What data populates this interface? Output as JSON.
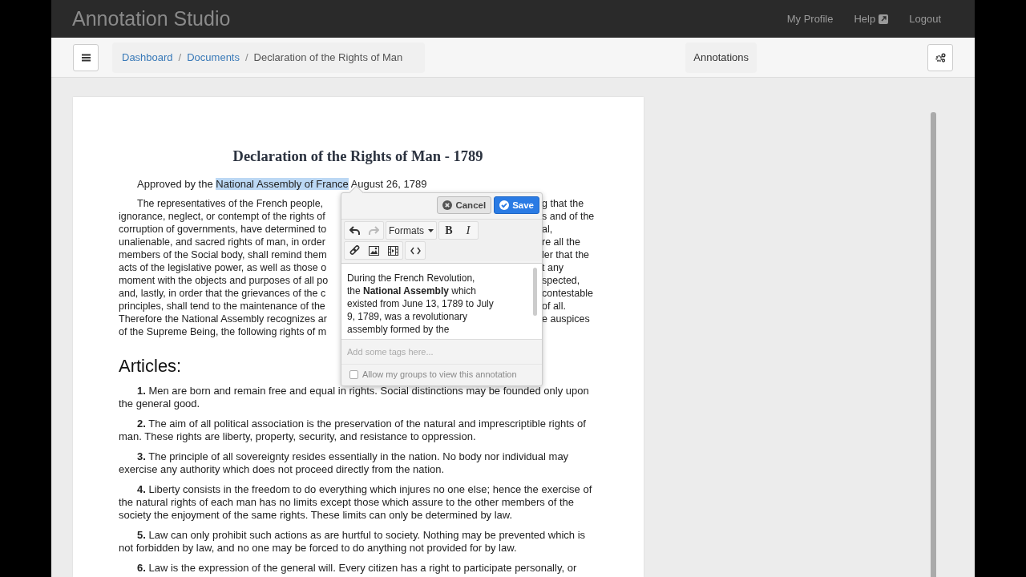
{
  "header": {
    "title": "Annotation Studio",
    "links": [
      {
        "label": "My Profile",
        "kind": "plain"
      },
      {
        "label": "Help",
        "kind": "external"
      },
      {
        "label": "Logout",
        "kind": "plain"
      }
    ]
  },
  "toolbar": {
    "separator": "/",
    "breadcrumbs": [
      {
        "label": "Dashboard",
        "kind": "link"
      },
      {
        "label": "Documents",
        "kind": "link"
      },
      {
        "label": "Declaration of the Rights of Man",
        "kind": "current"
      }
    ],
    "panel_title": "Annotations"
  },
  "document": {
    "title": "Declaration of the Rights of Man - 1789",
    "approval": [
      {
        "text": "Approved by the",
        "highlighted": false
      },
      {
        "text": "National Assembly of France",
        "highlighted": true
      },
      {
        "text": "August 26, 1789",
        "highlighted": false
      }
    ],
    "preamble_lines": [
      {
        "left": "The representatives of the French people,",
        "right": "g that the"
      },
      {
        "left": "ignorance, neglect, or contempt of the rights of",
        "right": "s and of the"
      },
      {
        "left": "corruption of governments, have determined to",
        "right": "al,"
      },
      {
        "left": "unalienable, and sacred rights of man, in order",
        "right": "re all the"
      },
      {
        "left": "members of the Social body, shall remind them",
        "right": "ler that the"
      },
      {
        "left": "acts of the legislative power, as well as those o",
        "right": "t any"
      },
      {
        "left": "moment with the objects and purposes of all po",
        "right": "spected,"
      },
      {
        "left": "and, lastly, in order that the grievances of the c",
        "right": "contestable"
      },
      {
        "left": "principles, shall tend to the maintenance of the",
        "right": "of all."
      },
      {
        "left": "Therefore the National Assembly recognizes ar",
        "right": "e auspices"
      },
      {
        "left": "of the Supreme Being, the following rights of m"
      }
    ],
    "section_heading": "Articles:",
    "articles": [
      "**1.** Men are born and remain free and equal in rights. Social distinctions may be founded only upon the general good.",
      "**2.** The aim of all political association is the preservation of the natural and imprescriptible rights of man. These rights are liberty, property, security, and resistance to oppression.",
      "**3.** The principle of all sovereignty resides essentially in the nation. No body nor individual may exercise any authority which does not proceed directly from the nation.",
      "**4.** Liberty consists in the freedom to do everything which injures no one else; hence the exercise of the natural rights of each man has no limits except those which assure to the other members of the society the enjoyment of the same rights. These limits can only be determined by law.",
      "**5.** Law can only prohibit such actions as are hurtful to society. Nothing may be prevented which is not forbidden by law, and no one may be forced to do anything not provided for by law.",
      "**6.** Law is the expression of the general will. Every citizen has a right to participate personally, or"
    ]
  },
  "editor": {
    "buttons": [
      {
        "label": "Cancel",
        "kind": "cancel"
      },
      {
        "label": "Save",
        "kind": "save"
      }
    ],
    "tool_rows": [
      [
        [
          {
            "kind": "undo",
            "disabled": false
          },
          {
            "kind": "redo",
            "disabled": true
          }
        ],
        [
          {
            "kind": "formats",
            "label": "Formats"
          }
        ],
        [
          {
            "kind": "bold",
            "label": "B"
          },
          {
            "kind": "italic",
            "label": "I"
          }
        ]
      ],
      [
        [
          {
            "kind": "link"
          },
          {
            "kind": "image"
          },
          {
            "kind": "media"
          }
        ],
        [
          {
            "kind": "code"
          }
        ]
      ]
    ],
    "body_lines": [
      "During the French Revolution,",
      "the **National Assembly** which",
      "existed from June 13, 1789 to July",
      "9, 1789, was a revolutionary",
      "assembly formed by the"
    ],
    "tags_placeholder": "Add some tags here...",
    "share": {
      "label": "Allow my groups to view this annotation",
      "checked": false
    }
  }
}
